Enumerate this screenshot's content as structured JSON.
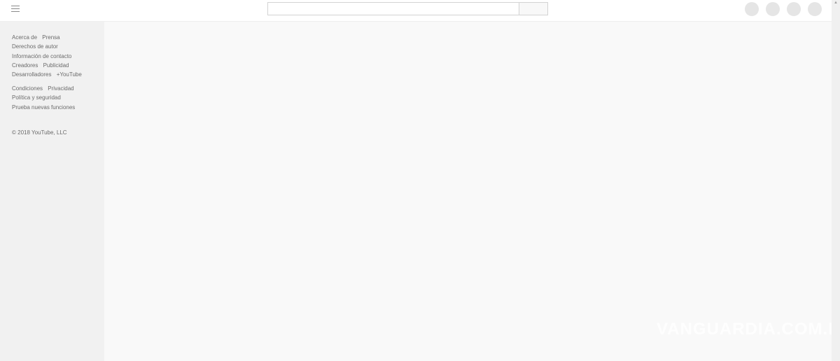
{
  "header": {
    "search": {
      "placeholder": "",
      "value": ""
    },
    "icons": [
      "menu-icon",
      "search-button",
      "apps-icon",
      "messages-icon",
      "settings-icon",
      "sign-in-icon"
    ]
  },
  "sidebar": {
    "footer_primary": [
      [
        "Acerca de",
        "Prensa"
      ],
      [
        "Derechos de autor"
      ],
      [
        "Información de contacto"
      ],
      [
        "Creadores",
        "Publicidad"
      ],
      [
        "Desarrolladores",
        "+YouTube"
      ]
    ],
    "footer_secondary": [
      [
        "Condiciones",
        "Privacidad"
      ],
      [
        "Política y seguridad"
      ],
      [
        "Prueba nuevas funciones"
      ]
    ],
    "copyright": "© 2018 YouTube, LLC"
  },
  "watermark": "VANGUARDIA.COM.MX",
  "colors": {
    "topbar": "#ffffff",
    "sidebar": "#f1f1f1",
    "main": "#f9f9f9",
    "placeholder_circle": "#e5e5e5",
    "footer_text": "#6b6b6b"
  }
}
